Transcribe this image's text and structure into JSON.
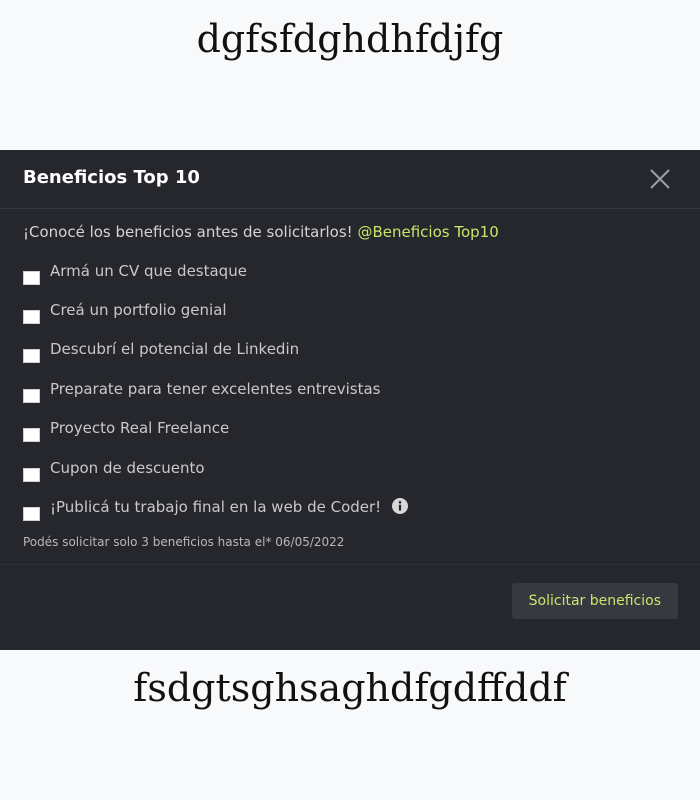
{
  "page": {
    "top_text": "dgfsfdghdhfdjfg",
    "bottom_text": "fsdgtsghsaghdfgdffddf"
  },
  "modal": {
    "title": "Beneficios Top 10",
    "close_icon": "close-icon",
    "intro_text": "¡Conocé los beneficios antes de solicitarlos!",
    "intro_tag": "@Beneficios Top10",
    "accent_color": "#c8e66a",
    "items": [
      {
        "label": "Armá un CV que destaque",
        "checked": false
      },
      {
        "label": "Creá un portfolio genial",
        "checked": false
      },
      {
        "label": "Descubrí el potencial de Linkedin",
        "checked": false
      },
      {
        "label": "Preparate para tener excelentes entrevistas",
        "checked": false
      },
      {
        "label": "Proyecto Real Freelance",
        "checked": false
      },
      {
        "label": "Cupon de descuento",
        "checked": false
      },
      {
        "label": "¡Publicá tu trabajo final en la web de Coder!",
        "checked": false,
        "icon": "info-icon"
      }
    ],
    "note": "Podés solicitar solo 3 beneficios hasta el* 06/05/2022",
    "submit_label": "Solicitar beneficios"
  }
}
